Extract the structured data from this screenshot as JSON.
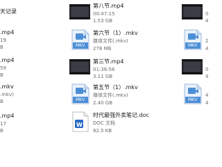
{
  "col_left": {
    "items": [
      {
        "title": "天记录",
        "line2": "",
        "line3": ""
      },
      {
        "title": ".mp4",
        "line2": "19",
        "line3": "B"
      },
      {
        "title": ".mp4",
        "line2": "59",
        "line3": "B"
      },
      {
        "title": ".mkv",
        "line2": ".mkv)",
        "line3": "B"
      },
      {
        "title": ".mp4",
        "line2": "17",
        "line3": "B"
      }
    ]
  },
  "col_mid": {
    "items": [
      {
        "title": "第八节.mp4",
        "line2": "00:47:15",
        "line3": "1.53 GB",
        "icon": "video-thumbnail-icon"
      },
      {
        "title": "第六节（1）.mkv",
        "line2": "媒体文件(.mkv)",
        "line3": "278 MB",
        "icon": "mkv-file-icon"
      },
      {
        "title": "第三节.mp4",
        "line2": "01:36:56",
        "line3": "3.11 GB",
        "icon": "video-thumbnail-icon"
      },
      {
        "title": "第五节（1）.mkv",
        "line2": "媒体文件(.mkv)",
        "line3": "2.40 GB",
        "icon": "mkv-file-icon"
      },
      {
        "title": "时代最强外卖笔记.doc",
        "line2": "DOC 文档",
        "line3": "82.5 KB",
        "icon": "word-doc-icon"
      }
    ],
    "mkv_label": "MKV",
    "doc_label": "W"
  },
  "col_right": {
    "items": [
      {
        "line2": "0",
        "line3": "4"
      },
      {
        "line2": "2",
        "line3": "4"
      },
      {
        "line2": "0",
        "line3": "4"
      },
      {
        "line2": "4",
        "line3": "4"
      },
      {
        "line2": "",
        "line3": ""
      }
    ],
    "mkv_label": "MKV"
  },
  "colors": {
    "mkv_blue": "#4d8fd6",
    "word_blue": "#2b6cc4",
    "text": "#1a1a1a",
    "muted": "#6b6b6b"
  }
}
